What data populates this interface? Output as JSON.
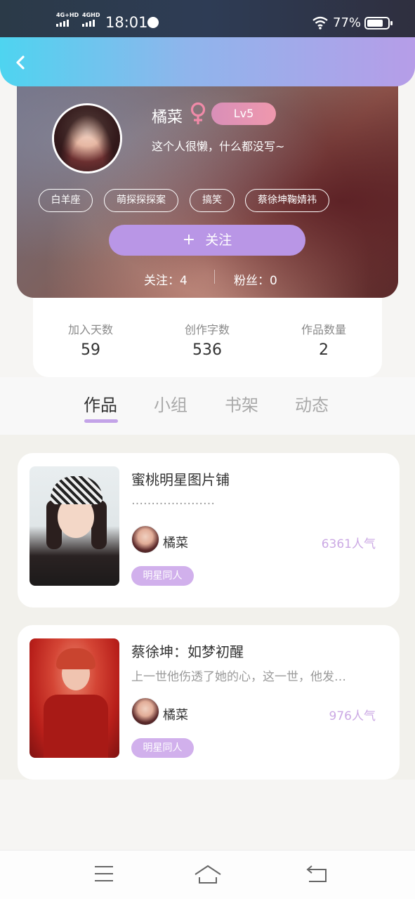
{
  "status_bar": {
    "signal1": "4G+HD",
    "signal2": "4GHD",
    "time": "18:01",
    "battery": "77%",
    "icons": [
      "signal-icon",
      "globe-icon",
      "wifi-icon",
      "battery-icon"
    ]
  },
  "nav": {
    "back_icon": "chevron-left-icon"
  },
  "profile": {
    "name": "橘菜",
    "gender_icon": "female-icon",
    "level": "Lv5",
    "bio": "这个人很懒，什么都没写~",
    "tags": [
      "白羊座",
      "萌探探探案",
      "搞笑",
      "蔡徐坤鞠婧祎"
    ],
    "follow_button": "关注",
    "follow_plus": "+",
    "following": "关注：4",
    "followers": "粉丝：0"
  },
  "stats": [
    {
      "label": "加入天数",
      "value": "59"
    },
    {
      "label": "创作字数",
      "value": "536"
    },
    {
      "label": "作品数量",
      "value": "2"
    }
  ],
  "tabs": [
    {
      "label": "作品",
      "active": true
    },
    {
      "label": "小组",
      "active": false
    },
    {
      "label": "书架",
      "active": false
    },
    {
      "label": "动态",
      "active": false
    }
  ],
  "works": [
    {
      "title": "蜜桃明星图片铺",
      "desc": "…………………",
      "author": "橘菜",
      "popularity": "6361人气",
      "category": "明星同人"
    },
    {
      "title": "蔡徐坤：如梦初醒",
      "desc": "上一世他伤透了她的心，这一世，他发…",
      "author": "橘菜",
      "popularity": "976人气",
      "category": "明星同人"
    }
  ],
  "bottom_nav": [
    "menu-icon",
    "home-icon",
    "back-icon"
  ],
  "colors": {
    "accent_purple": "#b996e6",
    "nav_gradient_start": "#4ed4f0",
    "nav_gradient_end": "#b69de8",
    "level_badge": "#ef98ad",
    "popularity": "#cba9e4"
  }
}
